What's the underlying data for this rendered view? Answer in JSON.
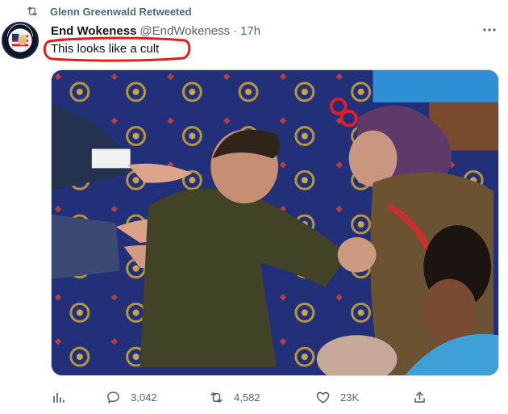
{
  "retweet": {
    "label": "Glenn Greenwald Retweeted"
  },
  "author": {
    "name": "End Wokeness",
    "handle": "@EndWokeness",
    "separator": "·",
    "time": "17h"
  },
  "avatar_badge": {
    "top_text": "I SUPPORT",
    "bottom_text": "FORMER TRUMP"
  },
  "tweet": {
    "text": "This looks like a cult"
  },
  "actions": {
    "replies": "3,042",
    "retweets": "4,582",
    "likes": "23K"
  },
  "colors": {
    "text_primary": "#0f1419",
    "text_secondary": "#536471",
    "annotation_red": "#e0201a",
    "border": "#cfd9de"
  },
  "icons": {
    "retweet": "retweet-icon",
    "more": "more-icon",
    "analytics": "analytics-icon",
    "reply": "reply-icon",
    "like": "heart-icon",
    "share": "share-icon"
  }
}
